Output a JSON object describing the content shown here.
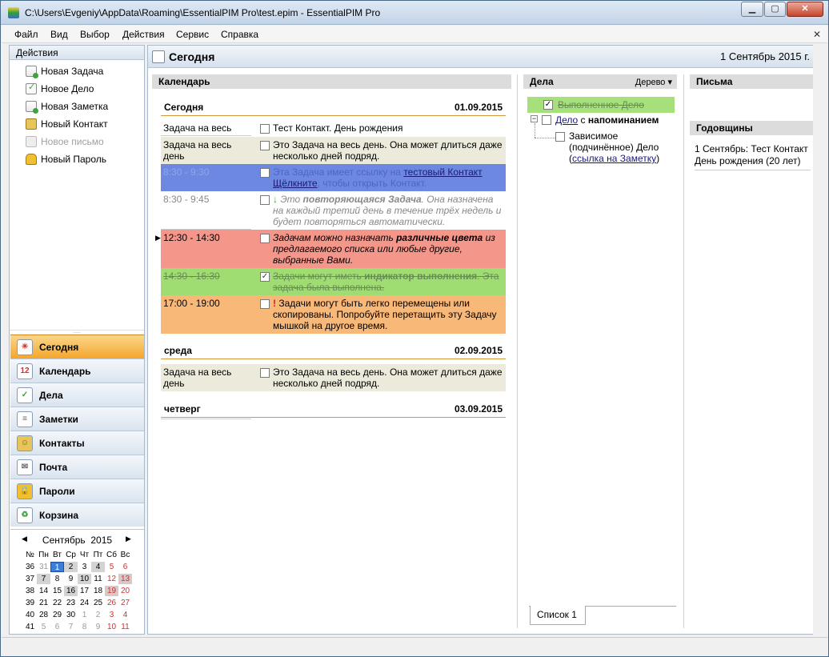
{
  "window": {
    "title": "C:\\Users\\Evgeniy\\AppData\\Roaming\\EssentialPIM Pro\\test.epim - EssentialPIM Pro"
  },
  "menu": [
    "Файл",
    "Вид",
    "Выбор",
    "Действия",
    "Сервис",
    "Справка"
  ],
  "actions": {
    "title": "Действия",
    "items": [
      {
        "label": "Новая Задача",
        "icon": "new-task-icon"
      },
      {
        "label": "Новое Дело",
        "icon": "new-todo-icon"
      },
      {
        "label": "Новая Заметка",
        "icon": "new-note-icon"
      },
      {
        "label": "Новый Контакт",
        "icon": "new-contact-icon"
      },
      {
        "label": "Новое письмо",
        "icon": "new-mail-icon",
        "disabled": true
      },
      {
        "label": "Новый Пароль",
        "icon": "new-password-icon"
      }
    ]
  },
  "nav": [
    {
      "label": "Сегодня",
      "icon": "today-icon",
      "active": true
    },
    {
      "label": "Календарь",
      "icon": "calendar-icon"
    },
    {
      "label": "Дела",
      "icon": "todo-icon"
    },
    {
      "label": "Заметки",
      "icon": "notes-icon"
    },
    {
      "label": "Контакты",
      "icon": "contacts-icon"
    },
    {
      "label": "Почта",
      "icon": "mail-icon"
    },
    {
      "label": "Пароли",
      "icon": "passwords-icon"
    },
    {
      "label": "Корзина",
      "icon": "trash-icon"
    }
  ],
  "minical": {
    "month": "Сентябрь",
    "year": "2015",
    "weekday_headers": [
      "№",
      "Пн",
      "Вт",
      "Ср",
      "Чт",
      "Пт",
      "Сб",
      "Вс"
    ],
    "weeks": [
      [
        "36",
        "31",
        "1",
        "2",
        "3",
        "4",
        "5",
        "6"
      ],
      [
        "37",
        "7",
        "8",
        "9",
        "10",
        "11",
        "12",
        "13"
      ],
      [
        "38",
        "14",
        "15",
        "16",
        "17",
        "18",
        "19",
        "20"
      ],
      [
        "39",
        "21",
        "22",
        "23",
        "24",
        "25",
        "26",
        "27"
      ],
      [
        "40",
        "28",
        "29",
        "30",
        "1",
        "2",
        "3",
        "4"
      ],
      [
        "41",
        "5",
        "6",
        "7",
        "8",
        "9",
        "10",
        "11"
      ]
    ]
  },
  "header": {
    "title": "Сегодня",
    "date": "1 Сентябрь 2015 г."
  },
  "calendar": {
    "title": "Календарь",
    "days": [
      {
        "name": "Сегодня",
        "date": "01.09.2015"
      },
      {
        "name": "среда",
        "date": "02.09.2015"
      },
      {
        "name": "четверг",
        "date": "03.09.2015"
      }
    ],
    "events": {
      "e1": {
        "time": "Задача на весь день",
        "text": "Тест Контакт. День рождения"
      },
      "e2": {
        "time": "Задача на весь день",
        "text": "Это Задача на весь день. Она может длиться даже несколько дней подряд."
      },
      "e3": {
        "time": "8:30 - 9:30",
        "text_a": "Эта Задача имеет ссылку на ",
        "link1": "тестовый Контакт",
        "link2": "Щёлкните",
        "text_b": ", чтобы открыть Контакт."
      },
      "e4": {
        "time": "8:30 - 9:45",
        "text_a": "Это ",
        "strong": "повторяющаяся Задача",
        "text_b": ". Она назначена на каждый третий день в течение трёх недель и будет повторяться автоматически."
      },
      "e5": {
        "time": "12:30 - 14:30",
        "text_a": "Задачам можно назначать ",
        "strong": "различные цвета",
        "text_b": " из предлагаемого списка или любые другие, выбранные Вами."
      },
      "e6": {
        "time": "14:30 - 16:30",
        "text_a": "Задачи могут иметь ",
        "strong": "индикатор выполнения",
        "text_b": ". Эта задача была выполнена."
      },
      "e7": {
        "time": "17:00 - 19:00",
        "text": "Задачи могут быть легко перемещены или скопированы. Попробуйте перетащить эту Задачу мышкой на другое время."
      },
      "e8": {
        "time": "Задача на весь день",
        "text": "Это Задача на весь день. Она может длиться даже несколько дней подряд."
      }
    }
  },
  "todo": {
    "title": "Дела",
    "view": "Дерево",
    "items": {
      "done": "Выполненное Дело",
      "reminder_a": "Дело",
      "reminder_b": " с ",
      "reminder_c": "напоминанием",
      "dep_text": "Зависимое (подчинённое) Дело",
      "dep_link": "ссылка на Заметку"
    },
    "tab": "Список 1"
  },
  "mail": {
    "title": "Письма"
  },
  "anniv": {
    "title": "Годовщины",
    "item": "1 Сентябрь:  Тест Контакт День рождения  (20 лет)"
  },
  "colors": {
    "allday": "#eceadb",
    "blue": "#6d88e0",
    "red": "#f4968a",
    "green": "#9fdc72",
    "orange": "#f8b878",
    "done_green": "#a6e07a",
    "accent": "#f4a62c"
  }
}
